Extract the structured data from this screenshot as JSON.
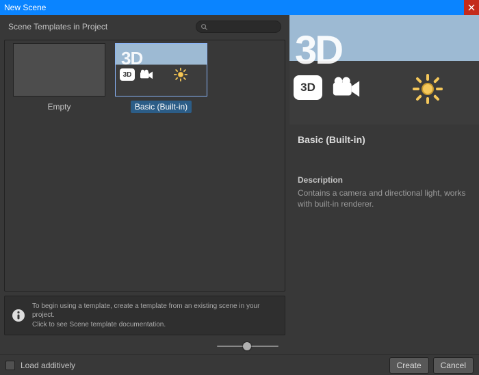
{
  "window": {
    "title": "New Scene"
  },
  "leftPanel": {
    "header": "Scene Templates in Project",
    "templates": [
      {
        "label": "Empty",
        "selected": false
      },
      {
        "label": "Basic (Built-in)",
        "selected": true
      }
    ],
    "hint": {
      "line1": "To begin using a template, create a template from an existing scene in your project.",
      "line2": "Click to see Scene template documentation."
    }
  },
  "rightPanel": {
    "title": "Basic (Built-in)",
    "descriptionHeader": "Description",
    "description": "Contains a camera and directional light, works with built-in renderer."
  },
  "footer": {
    "loadAdditively": "Load additively",
    "create": "Create",
    "cancel": "Cancel"
  },
  "badge3d": "3D"
}
